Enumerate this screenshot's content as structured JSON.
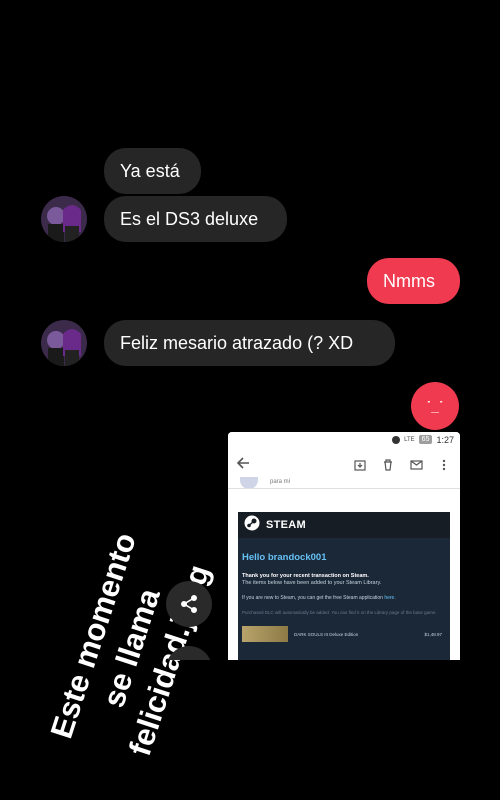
{
  "messages": [
    {
      "text": "Ya está"
    },
    {
      "text": "Es el DS3 deluxe"
    },
    {
      "text": "Nmms"
    },
    {
      "text": "Feliz mesario atrazado (? XD"
    }
  ],
  "emoji_reply": "˙_˙",
  "overlay_caption": [
    "Este momento",
    "se llama",
    "felicidad.jpeg"
  ],
  "attachment": {
    "status_bar": {
      "network": "LTE",
      "battery": "65",
      "time": "1:27"
    },
    "recipient": "para mí",
    "steam": {
      "brand": "STEAM",
      "greeting": "Hello brandock001",
      "line1": "Thank you for your recent transaction on Steam.",
      "line2": "The items below have been added to your Steam Library.",
      "line3": "If you are new to Steam, you can get the free Steam application",
      "line3_link": "here.",
      "line4": "Purchased DLC will automatically be added. You can find it on the Library page of the base game.",
      "item_name": "DARK SOULS III Deluxe Edition",
      "item_price": "$1,48.97"
    }
  },
  "colors": {
    "outgoing": "#ef3a4f",
    "incoming": "#262626",
    "steam_blue": "#66c0f4"
  },
  "icons": [
    "share-icon",
    "back-arrow-icon",
    "archive-icon",
    "delete-icon",
    "mail-icon",
    "more-vert-icon",
    "steam-logo-icon"
  ]
}
